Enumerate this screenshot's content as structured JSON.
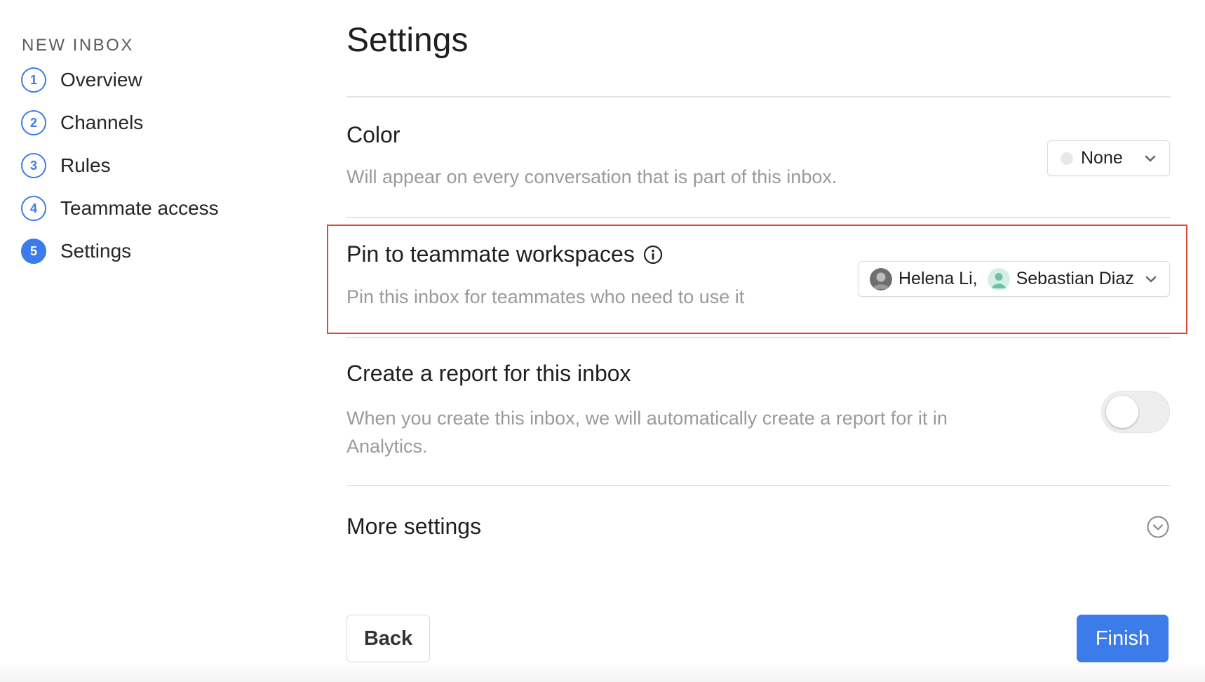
{
  "sidebar": {
    "title": "NEW INBOX",
    "steps": [
      {
        "num": "1",
        "label": "Overview"
      },
      {
        "num": "2",
        "label": "Channels"
      },
      {
        "num": "3",
        "label": "Rules"
      },
      {
        "num": "4",
        "label": "Teammate access"
      },
      {
        "num": "5",
        "label": "Settings"
      }
    ],
    "active_step": "5"
  },
  "main": {
    "title": "Settings",
    "color_section": {
      "title": "Color",
      "description": "Will appear on every conversation that is part of this inbox.",
      "selected": "None"
    },
    "pin_section": {
      "title": "Pin to teammate workspaces",
      "description": "Pin this inbox for teammates who need to use it",
      "teammates": [
        "Helena Li,",
        "Sebastian Diaz"
      ]
    },
    "report_section": {
      "title": "Create a report for this inbox",
      "description": "When you create this inbox, we will automatically create a report for it in Analytics.",
      "enabled": false
    },
    "more_settings": {
      "title": "More settings"
    }
  },
  "footer": {
    "back_label": "Back",
    "finish_label": "Finish"
  },
  "colors": {
    "accent": "#3b7bea",
    "highlight_border": "#e04a31",
    "muted_text": "#9a9a9a"
  },
  "icons": {
    "color_swatch": "empty-circle-icon",
    "dropdown": "chevron-down-icon",
    "info": "info-icon",
    "more_settings": "circle-chevron-down-icon"
  }
}
